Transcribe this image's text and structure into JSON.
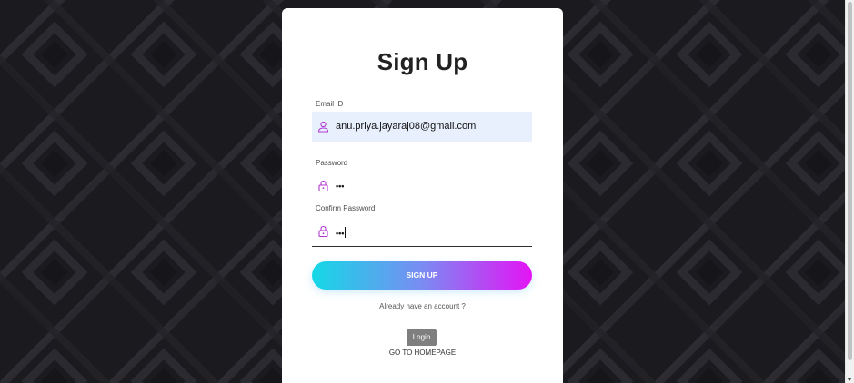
{
  "form": {
    "title": "Sign Up",
    "email": {
      "label": "Email ID",
      "value": "anu.priya.jayaraj08@gmail.com"
    },
    "password": {
      "label": "Password",
      "masked_value": "•••"
    },
    "confirm_password": {
      "label": "Confirm Password",
      "masked_value": "•••"
    },
    "signup_button_label": "SIGN UP",
    "already_text": "Already have an account ?",
    "login_button_label": "Login",
    "homepage_link_label": "GO TO HOMEPAGE"
  },
  "icons": {
    "email": "user-icon",
    "password": "lock-icon",
    "confirm_password": "lock-icon"
  },
  "colors": {
    "background": "#1d1c21",
    "card": "#ffffff",
    "gradient_start": "#14d8e6",
    "gradient_end": "#e414f4",
    "icon_accent": "#b03ad0",
    "autofill": "#e8f0fe",
    "login_button": "#7f7f7f"
  }
}
